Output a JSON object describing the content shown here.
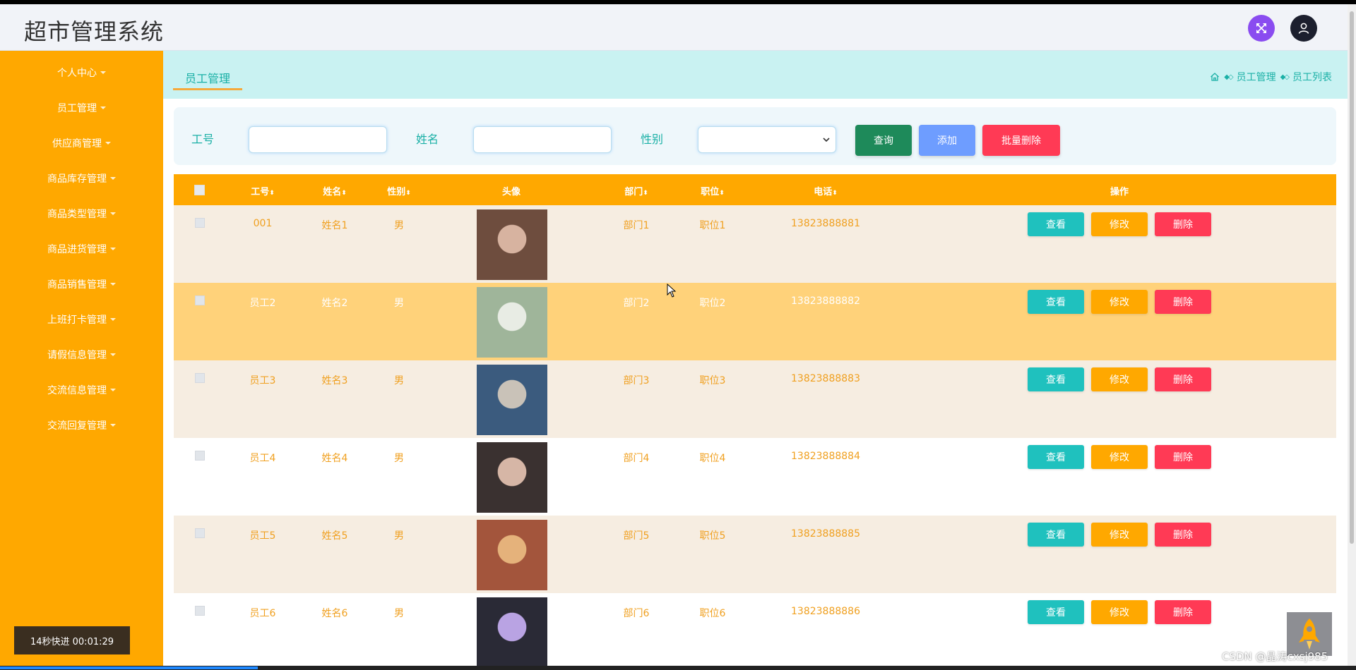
{
  "app": {
    "title": "超市管理系统"
  },
  "header": {
    "expand_icon": "expand-icon",
    "user_icon": "user-icon"
  },
  "sidebar": {
    "items": [
      {
        "label": "个人中心"
      },
      {
        "label": "员工管理"
      },
      {
        "label": "供应商管理"
      },
      {
        "label": "商品库存管理"
      },
      {
        "label": "商品类型管理"
      },
      {
        "label": "商品进货管理"
      },
      {
        "label": "商品销售管理"
      },
      {
        "label": "上班打卡管理"
      },
      {
        "label": "请假信息管理"
      },
      {
        "label": "交流信息管理"
      },
      {
        "label": "交流回复管理"
      }
    ],
    "color": "#ffa800"
  },
  "tabs": {
    "active": "员工管理"
  },
  "breadcrumb": {
    "level1": "员工管理",
    "level2": "员工列表"
  },
  "search": {
    "employee_no_label": "工号",
    "name_label": "姓名",
    "gender_label": "性别",
    "employee_no_value": "",
    "name_value": "",
    "gender_value": "",
    "query_label": "查询",
    "add_label": "添加",
    "batch_delete_label": "批量删除"
  },
  "table": {
    "columns": {
      "employee_no": "工号",
      "name": "姓名",
      "gender": "性别",
      "avatar": "头像",
      "department": "部门",
      "position": "职位",
      "phone": "电话",
      "actions": "操作"
    },
    "sort_icon": "⬍",
    "action_labels": {
      "view": "查看",
      "edit": "修改",
      "delete": "删除"
    },
    "rows": [
      {
        "employee_no": "001",
        "name": "姓名1",
        "gender": "男",
        "department": "部门1",
        "position": "职位1",
        "phone": "13823888881"
      },
      {
        "employee_no": "员工2",
        "name": "姓名2",
        "gender": "男",
        "department": "部门2",
        "position": "职位2",
        "phone": "13823888882"
      },
      {
        "employee_no": "员工3",
        "name": "姓名3",
        "gender": "男",
        "department": "部门3",
        "position": "职位3",
        "phone": "13823888883"
      },
      {
        "employee_no": "员工4",
        "name": "姓名4",
        "gender": "男",
        "department": "部门4",
        "position": "职位4",
        "phone": "13823888884"
      },
      {
        "employee_no": "员工5",
        "name": "姓名5",
        "gender": "男",
        "department": "部门5",
        "position": "职位5",
        "phone": "13823888885"
      },
      {
        "employee_no": "员工6",
        "name": "姓名6",
        "gender": "男",
        "department": "部门6",
        "position": "职位6",
        "phone": "13823888886"
      }
    ]
  },
  "overlay": {
    "timer_text": "14秒快进    00:01:29",
    "watermark": "CSDN @晶涛cxsj985",
    "progress": 0.19
  },
  "colors": {
    "accent": "#ffa800",
    "teal": "#1ab0a6",
    "query": "#1e8a5a",
    "add": "#6e9dff",
    "delete": "#ff3a55"
  }
}
